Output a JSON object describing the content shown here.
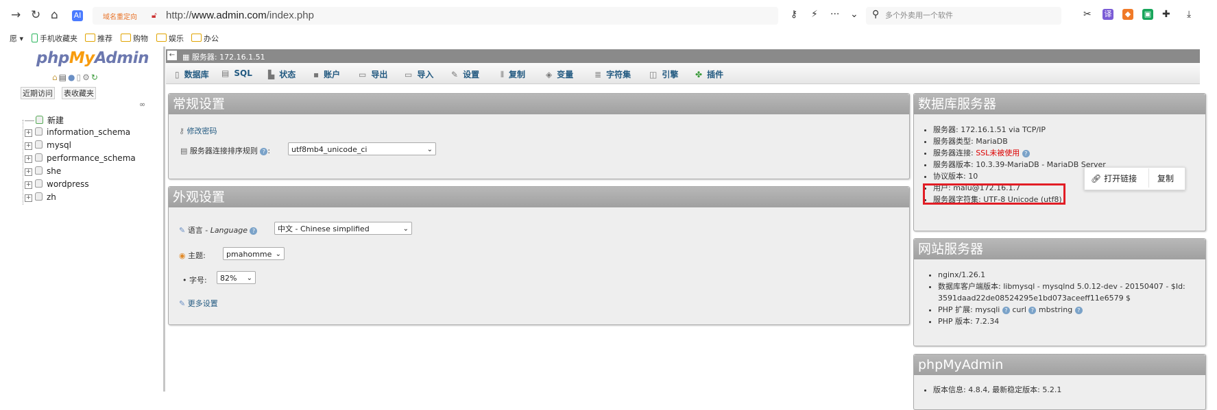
{
  "browser": {
    "redirect_label": "域名重定向",
    "url_prefix": "http://",
    "url_domain": "www.admin.com",
    "url_path": "/index.php",
    "search_placeholder": "多个外卖用一个软件"
  },
  "bookmarks": {
    "left_char": "愿",
    "items": [
      "手机收藏夹",
      "推荐",
      "购物",
      "娱乐",
      "办公"
    ]
  },
  "sidebar": {
    "logo_php": "php",
    "logo_my": "My",
    "logo_admin": "Admin",
    "recent": "近期访问",
    "favorites": "表收藏夹",
    "new": "新建",
    "databases": [
      "information_schema",
      "mysql",
      "performance_schema",
      "she",
      "wordpress",
      "zh"
    ]
  },
  "topbar": {
    "server": "服务器: 172.16.1.51",
    "tabs": [
      "数据库",
      "SQL",
      "状态",
      "账户",
      "导出",
      "导入",
      "设置",
      "复制",
      "变量",
      "字符集",
      "引擎",
      "插件"
    ]
  },
  "general": {
    "title": "常规设置",
    "change_password": "修改密码",
    "collation_label": "服务器连接排序规则",
    "collation_value": "utf8mb4_unicode_ci"
  },
  "appearance": {
    "title": "外观设置",
    "language_label": "语言 - ",
    "language_italic": "Language",
    "language_value": "中文 - Chinese simplified",
    "theme_label": "主题:",
    "theme_value": "pmahomme",
    "fontsize_label": "字号:",
    "fontsize_value": "82%",
    "more_settings": "更多设置"
  },
  "db_server": {
    "title": "数据库服务器",
    "server": "服务器: 172.16.1.51 via TCP/IP",
    "type": "服务器类型: MariaDB",
    "conn_label": "服务器连接: ",
    "conn_value": "SSL未被使用",
    "version": "服务器版本: 10.3.39-MariaDB - MariaDB Server",
    "protocol": "协议版本: 10",
    "user": "用户: malu@172.16.1.7",
    "charset": "服务器字符集: UTF-8 Unicode (utf8)"
  },
  "popup": {
    "open_link": "打开链接",
    "copy": "复制"
  },
  "web_server": {
    "title": "网站服务器",
    "nginx": "nginx/1.26.1",
    "client_line1": "数据库客户端版本: libmysql - mysqlnd 5.0.12-dev - 20150407 - $Id:",
    "client_line2": "3591daad22de08524295e1bd073aceeff11e6579 $",
    "php_ext_label": "PHP 扩展: ",
    "php_ext_mysqli": "mysqli",
    "php_ext_curl": "curl",
    "php_ext_mbstring": "mbstring",
    "php_version": "PHP 版本: 7.2.34"
  },
  "pma_panel": {
    "title": "phpMyAdmin",
    "version": "版本信息: 4.8.4, 最新稳定版本: 5.2.1"
  }
}
